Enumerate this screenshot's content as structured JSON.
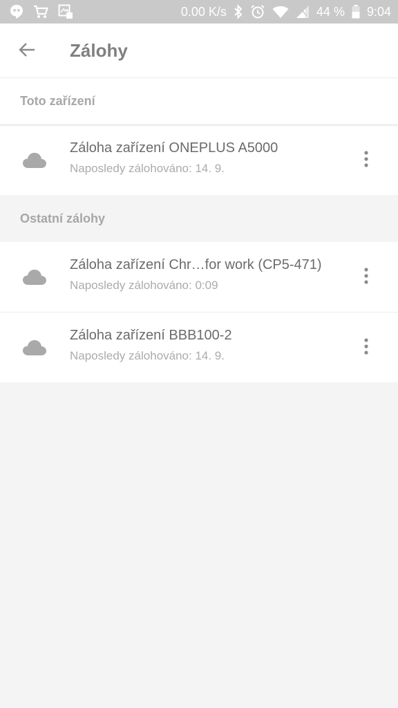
{
  "status_bar": {
    "network_speed": "0.00 K/s",
    "battery_percent": "44 %",
    "time": "9:04",
    "icons": [
      "hangouts-icon",
      "shopping-cart-icon",
      "screenshot-icon",
      "bluetooth-icon",
      "alarm-icon",
      "wifi-icon",
      "signal-icon",
      "battery-icon"
    ]
  },
  "header": {
    "title": "Zálohy",
    "back_icon": "arrow-left-icon"
  },
  "sections": [
    {
      "label": "Toto zařízení",
      "items": [
        {
          "title": "Záloha zařízení ONEPLUS A5000",
          "subtitle": "Naposledy zálohováno: 14. 9."
        }
      ]
    },
    {
      "label": "Ostatní zálohy",
      "items": [
        {
          "title": "Záloha zařízení Chr…for work (CP5-471)",
          "subtitle": "Naposledy zálohováno: 0:09"
        },
        {
          "title": "Záloha zařízení BBB100-2",
          "subtitle": "Naposledy zálohováno: 14. 9."
        }
      ]
    }
  ],
  "colors": {
    "status_bar": "#c9c9c9",
    "background": "#f4f4f4",
    "surface": "#ffffff",
    "icon_gray": "#a9a9a9"
  }
}
